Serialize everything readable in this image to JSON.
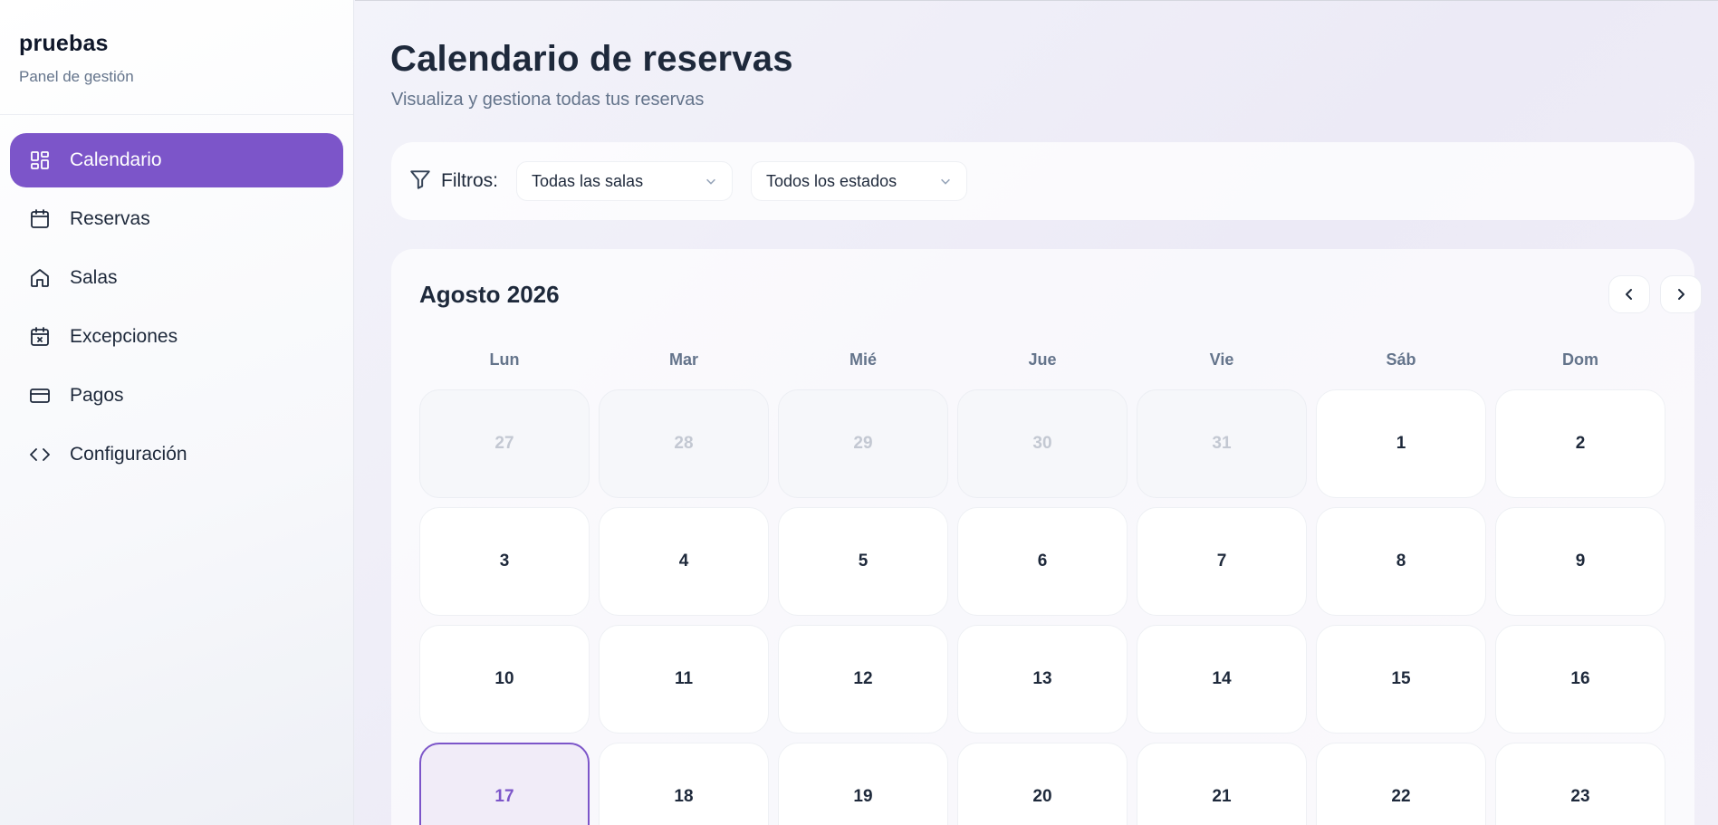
{
  "brand": {
    "name": "pruebas",
    "subtitle": "Panel de gestión"
  },
  "sidebar": {
    "items": [
      {
        "label": "Calendario",
        "icon": "dashboard-grid-icon",
        "active": true
      },
      {
        "label": "Reservas",
        "icon": "calendar-icon",
        "active": false
      },
      {
        "label": "Salas",
        "icon": "home-icon",
        "active": false
      },
      {
        "label": "Excepciones",
        "icon": "calendar-x-icon",
        "active": false
      },
      {
        "label": "Pagos",
        "icon": "credit-card-icon",
        "active": false
      },
      {
        "label": "Configuración",
        "icon": "code-icon",
        "active": false
      }
    ]
  },
  "header": {
    "title": "Calendario de reservas",
    "subtitle": "Visualiza y gestiona todas tus reservas"
  },
  "filters": {
    "label": "Filtros:",
    "room_select": "Todas las salas",
    "status_select": "Todos los estados"
  },
  "calendar": {
    "month_label": "Agosto 2026",
    "weekdays": [
      "Lun",
      "Mar",
      "Mié",
      "Jue",
      "Vie",
      "Sáb",
      "Dom"
    ],
    "today": "17",
    "weeks": [
      [
        {
          "day": "27",
          "outside": true
        },
        {
          "day": "28",
          "outside": true
        },
        {
          "day": "29",
          "outside": true
        },
        {
          "day": "30",
          "outside": true
        },
        {
          "day": "31",
          "outside": true
        },
        {
          "day": "1",
          "outside": false
        },
        {
          "day": "2",
          "outside": false
        }
      ],
      [
        {
          "day": "3",
          "outside": false
        },
        {
          "day": "4",
          "outside": false
        },
        {
          "day": "5",
          "outside": false
        },
        {
          "day": "6",
          "outside": false
        },
        {
          "day": "7",
          "outside": false
        },
        {
          "day": "8",
          "outside": false
        },
        {
          "day": "9",
          "outside": false
        }
      ],
      [
        {
          "day": "10",
          "outside": false
        },
        {
          "day": "11",
          "outside": false
        },
        {
          "day": "12",
          "outside": false
        },
        {
          "day": "13",
          "outside": false
        },
        {
          "day": "14",
          "outside": false
        },
        {
          "day": "15",
          "outside": false
        },
        {
          "day": "16",
          "outside": false
        }
      ],
      [
        {
          "day": "17",
          "outside": false
        },
        {
          "day": "18",
          "outside": false
        },
        {
          "day": "19",
          "outside": false
        },
        {
          "day": "20",
          "outside": false
        },
        {
          "day": "21",
          "outside": false
        },
        {
          "day": "22",
          "outside": false
        },
        {
          "day": "23",
          "outside": false
        }
      ]
    ]
  },
  "colors": {
    "accent": "#7c55c9",
    "muted_text": "#64748b",
    "outside_day_text": "#c3c8d2"
  }
}
